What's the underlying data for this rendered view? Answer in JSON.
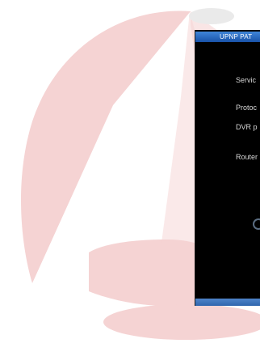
{
  "watermark": {
    "brand_color": "#f5d0d0",
    "icon": "brand-logo-watermark"
  },
  "dialog": {
    "title": "UPNP PAT",
    "accent_color": "#1a5fb4",
    "fields": {
      "service": "Servic",
      "protocol": "Protoc",
      "dvr_port": "DVR p",
      "router": "Router"
    },
    "partial_button_icon": "circular-button-edge"
  }
}
